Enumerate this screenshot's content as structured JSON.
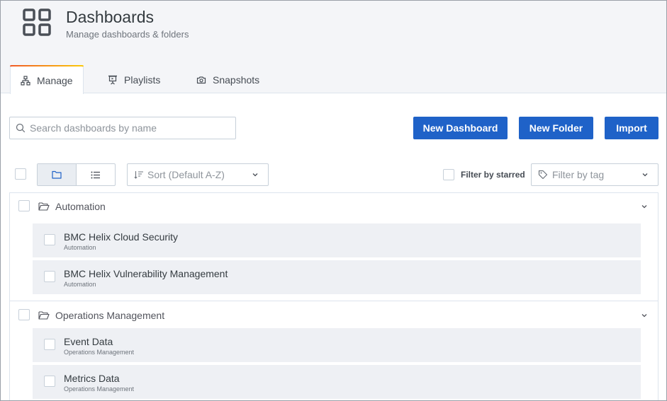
{
  "header": {
    "title": "Dashboards",
    "subtitle": "Manage dashboards & folders",
    "icon": "dashboard-grid-icon"
  },
  "tabs": [
    {
      "label": "Manage",
      "icon": "sitemap-icon",
      "active": true
    },
    {
      "label": "Playlists",
      "icon": "presentation-icon",
      "active": false
    },
    {
      "label": "Snapshots",
      "icon": "camera-icon",
      "active": false
    }
  ],
  "toolbar": {
    "search_placeholder": "Search dashboards by name",
    "new_dashboard_label": "New Dashboard",
    "new_folder_label": "New Folder",
    "import_label": "Import"
  },
  "filters": {
    "sort_placeholder": "Sort (Default A-Z)",
    "starred_label": "Filter by starred",
    "tag_placeholder": "Filter by tag",
    "layout_mode": "folders"
  },
  "folders": [
    {
      "name": "Automation",
      "expanded": true,
      "dashboards": [
        {
          "title": "BMC Helix Cloud Security",
          "folder": "Automation"
        },
        {
          "title": "BMC Helix Vulnerability Management",
          "folder": "Automation"
        }
      ]
    },
    {
      "name": "Operations Management",
      "expanded": true,
      "dashboards": [
        {
          "title": "Event Data",
          "folder": "Operations Management"
        },
        {
          "title": "Metrics Data",
          "folder": "Operations Management"
        }
      ]
    }
  ],
  "colors": {
    "primary_button": "#1f62c8",
    "tab_accent": "#eb7b18",
    "row_background": "#eef0f4"
  }
}
